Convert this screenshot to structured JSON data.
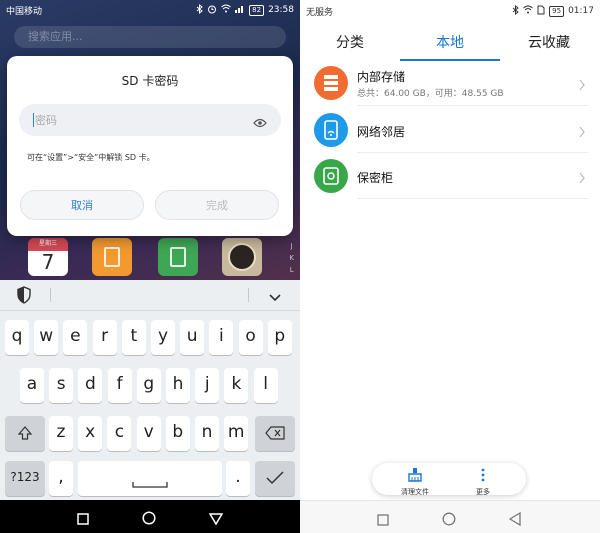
{
  "left": {
    "status": {
      "carrier": "中国移动",
      "battery": "82",
      "time": "23:58"
    },
    "search": {
      "placeholder": "搜索应用..."
    },
    "dialog": {
      "title": "SD 卡密码",
      "password_placeholder": "密码",
      "hint": "可在“设置”>“安全”中解锁 SD 卡。",
      "cancel_label": "取消",
      "done_label": "完成"
    },
    "home_tiles": {
      "calendar_weekday": "星期三",
      "calendar_day": "7"
    },
    "az_index": [
      "J",
      "K",
      "L"
    ],
    "keyboard": {
      "row1": [
        "q",
        "w",
        "e",
        "r",
        "t",
        "y",
        "u",
        "i",
        "o",
        "p"
      ],
      "row2": [
        "a",
        "s",
        "d",
        "f",
        "g",
        "h",
        "j",
        "k",
        "l"
      ],
      "row3": [
        "z",
        "x",
        "c",
        "v",
        "b",
        "n",
        "m"
      ],
      "numbers_key": "?123",
      "comma_key": ",",
      "period_key": "."
    }
  },
  "right": {
    "status": {
      "carrier": "无服务",
      "battery": "95",
      "time": "01:17"
    },
    "tabs": [
      {
        "label": "分类",
        "active": false
      },
      {
        "label": "本地",
        "active": true
      },
      {
        "label": "云收藏",
        "active": false
      }
    ],
    "items": [
      {
        "label": "内部存储",
        "detail": "总共：64.00 GB，可用：48.55 GB",
        "color": "#f26b30"
      },
      {
        "label": "网络邻居",
        "color": "#1e9ae8"
      },
      {
        "label": "保密柜",
        "color": "#3aa64a"
      }
    ],
    "bottom_actions": [
      {
        "label": "清理文件"
      },
      {
        "label": "更多"
      }
    ]
  },
  "colors": {
    "accent": "#1a75d4"
  }
}
